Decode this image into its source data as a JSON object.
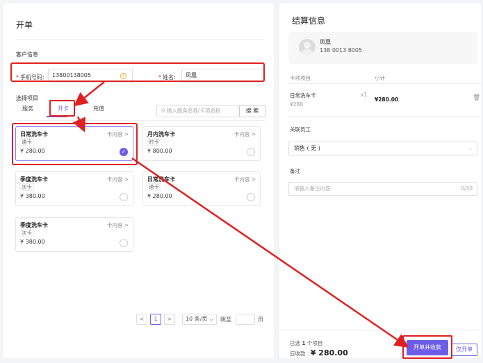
{
  "order": {
    "title": "开单",
    "customer_section": "客户信息",
    "phone_label": "手机号码",
    "phone_value": "13800138005",
    "name_label": "姓名",
    "name_value": "凤凰",
    "project_section": "选择项目",
    "tabs": [
      "服务",
      "开卡",
      "充值"
    ],
    "search_placeholder": "输入服务名称/卡项名称",
    "search_button": "搜 索",
    "cards": [
      {
        "name": "日常洗车卡",
        "link": "卡内容 >",
        "type": "通卡",
        "price": "¥ 280.00"
      },
      {
        "name": "月内洗车卡",
        "link": "卡内容 >",
        "type": "时卡",
        "price": "¥ 800.00"
      },
      {
        "name": "季度洗车卡",
        "link": "卡内容 >",
        "type": "次卡",
        "price": "¥ 380.00"
      },
      {
        "name": "日常洗车卡",
        "link": "卡内容 >",
        "type": "通卡",
        "price": "¥ 280.00"
      },
      {
        "name": "季度洗车卡",
        "link": "卡内容 >",
        "type": "次卡",
        "price": "¥ 380.00"
      }
    ],
    "pagination": {
      "prev": "<",
      "page": "1",
      "next": ">",
      "size": "10 条/页",
      "jump": "跳至",
      "page_unit": "页"
    }
  },
  "checkout": {
    "title": "结算信息",
    "customer_name": "凤凰",
    "customer_phone": "138 0013 8005",
    "col_item": "卡项项目",
    "col_subtotal": "小计",
    "item_name": "日常洗车卡",
    "item_unit_price": "¥280",
    "item_qty": "x1",
    "item_subtotal": "¥280.00",
    "staff_label": "关联员工",
    "staff_value": "销售 ( 无 )",
    "note_label": "备注",
    "note_placeholder": "请输入备注内容",
    "note_count": "0/30",
    "selected_text_pre": "已选",
    "selected_count": "1",
    "selected_text_post": "个项目",
    "due_label": "应收款 :",
    "due_amount": "¥ 280.00",
    "primary_button": "开单并收款",
    "secondary_button": "仅开单"
  },
  "colors": {
    "accent": "#6c5ce7",
    "annotation": "#e02020"
  }
}
